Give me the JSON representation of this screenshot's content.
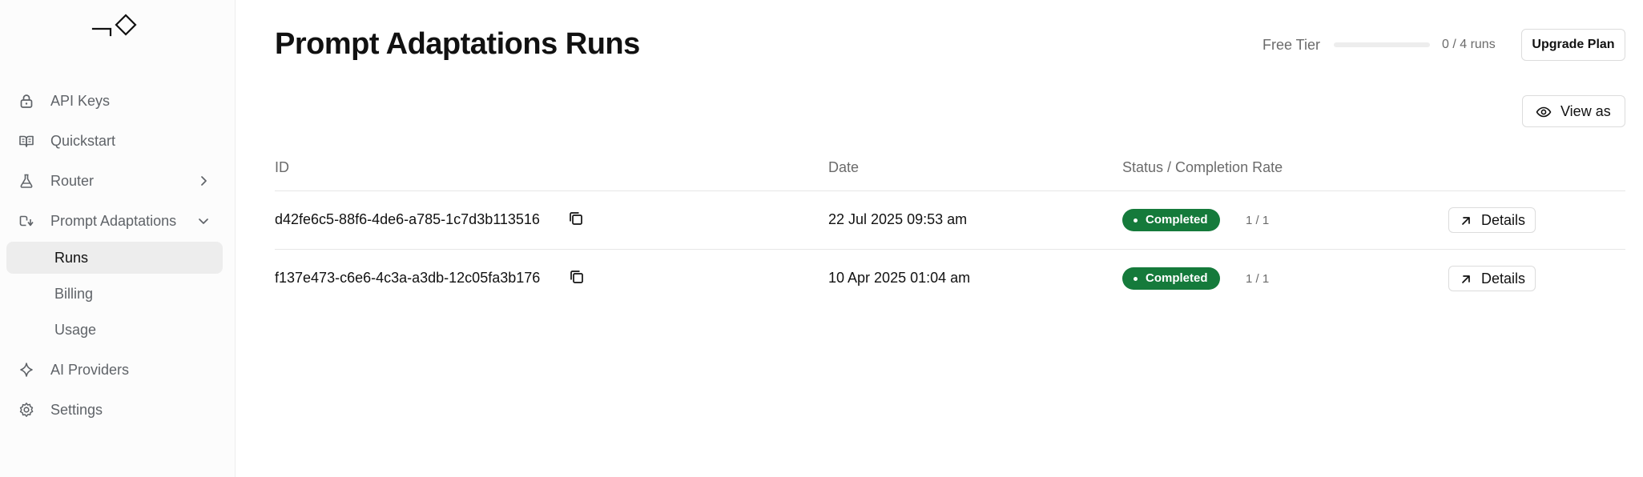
{
  "sidebar": {
    "items": [
      {
        "label": "API Keys",
        "icon": "lock-icon"
      },
      {
        "label": "Quickstart",
        "icon": "book-icon"
      },
      {
        "label": "Router",
        "icon": "flask-icon",
        "chevron": "chevron-right-icon"
      },
      {
        "label": "Prompt Adaptations",
        "icon": "route-icon",
        "chevron": "chevron-down-icon"
      },
      {
        "label": "AI Providers",
        "icon": "sparkle-icon"
      },
      {
        "label": "Settings",
        "icon": "gear-icon"
      }
    ],
    "subitems": [
      {
        "label": "Runs",
        "active": true
      },
      {
        "label": "Billing",
        "active": false
      },
      {
        "label": "Usage",
        "active": false
      }
    ]
  },
  "header": {
    "title": "Prompt Adaptations Runs",
    "tier_label": "Free Tier",
    "tier_usage": "0 / 4 runs",
    "tier_progress": 0,
    "upgrade_label": "Upgrade Plan",
    "view_as_label": "View as"
  },
  "table": {
    "columns": [
      "ID",
      "Date",
      "Status / Completion Rate"
    ],
    "rows": [
      {
        "id": "d42fe6c5-88f6-4de6-a785-1c7d3b113516",
        "date": "22 Jul 2025 09:53 am",
        "status": "Completed",
        "rate": "1 / 1",
        "action": "Details"
      },
      {
        "id": "f137e473-c6e6-4c3a-a3db-12c05fa3b176",
        "date": "10 Apr 2025 01:04 am",
        "status": "Completed",
        "rate": "1 / 1",
        "action": "Details"
      }
    ]
  },
  "colors": {
    "status_completed": "#157a3b",
    "active_nav_bg": "#ededed"
  }
}
